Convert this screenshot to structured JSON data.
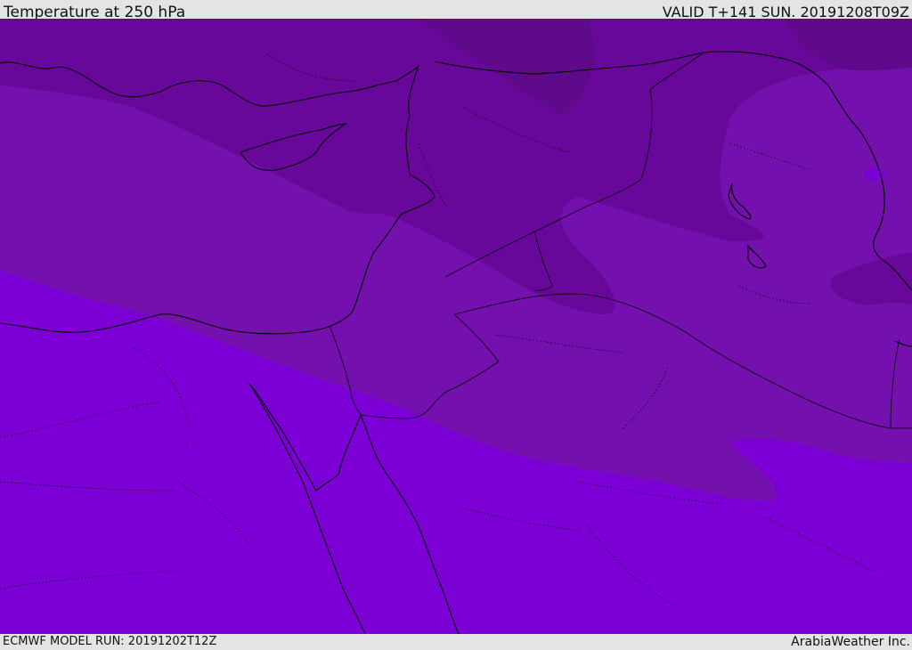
{
  "header": {
    "title": "Temperature at 250 hPa",
    "valid_time": "VALID T+141 SUN. 20191208T09Z"
  },
  "footer": {
    "model_run": "ECMWF MODEL RUN: 20191202T12Z",
    "credit": "ArabiaWeather Inc."
  },
  "map": {
    "field": "Temperature at 250 hPa",
    "colors": {
      "band_coldest": "#5e0a8a",
      "band_cold": "#68089a",
      "band_mid": "#7410ae",
      "band_warm": "#7c00d6",
      "coastline": "#000000"
    }
  }
}
